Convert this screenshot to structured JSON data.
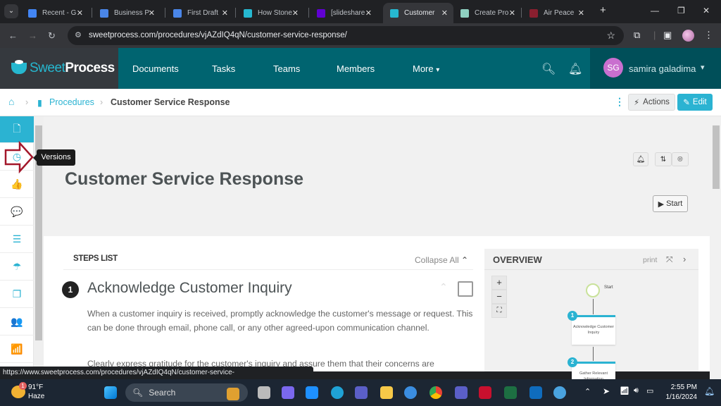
{
  "browser": {
    "tabs": [
      {
        "title": "Recent - G",
        "icon": "google-drive-icon",
        "color": "#4285f4"
      },
      {
        "title": "Business P",
        "icon": "google-docs-icon",
        "color": "#4a86e8"
      },
      {
        "title": "First Draft",
        "icon": "google-docs-icon",
        "color": "#4a86e8"
      },
      {
        "title": "How Stone",
        "icon": "sweetprocess-icon",
        "color": "#26b8d0"
      },
      {
        "title": "[slideshare",
        "icon": "yahoo-icon",
        "color": "#6001d2"
      },
      {
        "title": "Customer",
        "icon": "sweetprocess-icon",
        "color": "#26b8d0",
        "active": true
      },
      {
        "title": "Create Pro",
        "icon": "page-icon",
        "color": "#8fd1c1"
      },
      {
        "title": "Air Peace",
        "icon": "airpeace-icon",
        "color": "#8a1f2f"
      }
    ],
    "url": "sweetprocess.com/procedures/vjAZdIQ4qN/customer-service-response/",
    "status_url": "https://www.sweetprocess.com/procedures/vjAZdIQ4qN/customer-service-response/version/2056877/"
  },
  "app": {
    "brand_light": "Sweet",
    "brand_bold": "Process",
    "nav": [
      "Documents",
      "Tasks",
      "Teams",
      "Members",
      "More"
    ],
    "user": {
      "initials": "SG",
      "name": "samira galadima"
    },
    "accent": "#2bb3d2",
    "header_color": "#006470"
  },
  "breadcrumb": {
    "section": "Procedures",
    "current": "Customer Service Response"
  },
  "toolbar": {
    "actions_label": "Actions",
    "edit_label": "Edit"
  },
  "sidebar": {
    "items": [
      {
        "icon": "document-icon",
        "glyph": "🗋",
        "active": true
      },
      {
        "icon": "clock-icon",
        "glyph": "◷"
      },
      {
        "icon": "thumbs-up-icon",
        "glyph": "👍"
      },
      {
        "icon": "comments-icon",
        "glyph": "💬"
      },
      {
        "icon": "checklist-icon",
        "glyph": "☰"
      },
      {
        "icon": "umbrella-icon",
        "glyph": "☂"
      },
      {
        "icon": "copy-icon",
        "glyph": "❐"
      },
      {
        "icon": "users-icon",
        "glyph": "👥"
      },
      {
        "icon": "signal-bars-icon",
        "glyph": "📶"
      }
    ],
    "tooltip": "Versions"
  },
  "procedure": {
    "title": "Customer Service Response",
    "start_label": "Start",
    "steps_list_label": "STEPS LIST",
    "collapse_all_label": "Collapse All",
    "steps": [
      {
        "number": "1",
        "title": "Acknowledge Customer Inquiry",
        "paragraphs": [
          "When a customer inquiry is received, promptly acknowledge the customer's message or request. This can be done through email, phone call, or any other agreed-upon communication channel.",
          "Clearly express gratitude for the customer's inquiry and assure them that their concerns are"
        ]
      }
    ]
  },
  "overview": {
    "title": "OVERVIEW",
    "print_label": "print",
    "start_node": "Start",
    "nodes": [
      {
        "number": "1",
        "label": "Acknowledge Customer Inquiry"
      },
      {
        "number": "2",
        "label": "Gather Relevant Information"
      }
    ]
  },
  "taskbar": {
    "weather_temp": "91°F",
    "weather_desc": "Haze",
    "weather_badge": "1",
    "search_placeholder": "Search",
    "time": "2:55 PM",
    "date": "1/16/2024"
  }
}
